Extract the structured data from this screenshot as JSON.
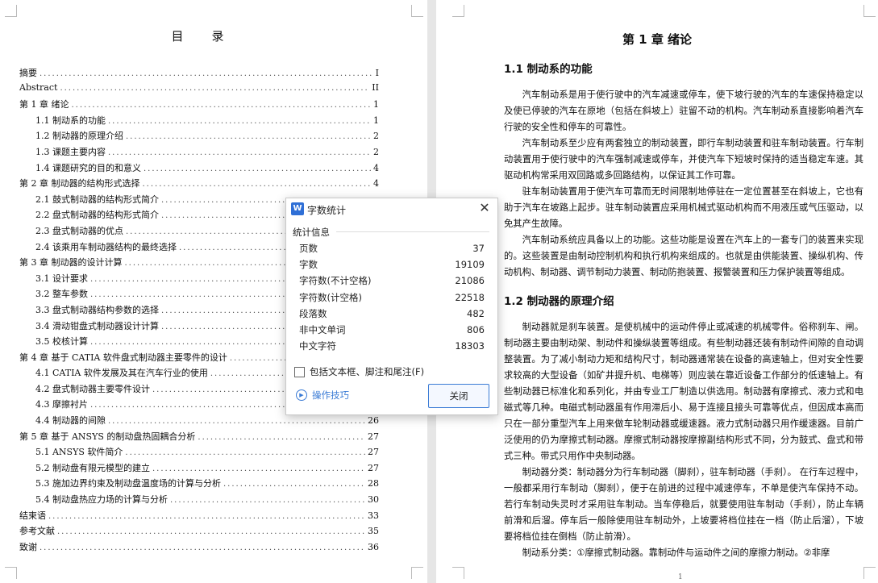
{
  "toc": {
    "title": "目　录",
    "entries": [
      {
        "label": "摘要",
        "page": "I",
        "level": 1
      },
      {
        "label": "Abstract",
        "page": "II",
        "level": 1
      },
      {
        "label": "第 1 章  绪论",
        "page": "1",
        "level": 1
      },
      {
        "label": "1.1 制动系的功能",
        "page": "1",
        "level": 2
      },
      {
        "label": "1.2 制动器的原理介绍",
        "page": "2",
        "level": 2
      },
      {
        "label": "1.3 课题主要内容",
        "page": "2",
        "level": 2
      },
      {
        "label": "1.4 课题研究的目的和意义",
        "page": "4",
        "level": 2
      },
      {
        "label": "第 2 章  制动器的结构形式选择",
        "page": "4",
        "level": 1
      },
      {
        "label": "2.1 鼓式制动器的结构形式简介",
        "page": "",
        "level": 2
      },
      {
        "label": "2.2 盘式制动器的结构形式简介",
        "page": "",
        "level": 2
      },
      {
        "label": "2.3 盘式制动器的优点",
        "page": "",
        "level": 2
      },
      {
        "label": "2.4 该乘用车制动器结构的最终选择",
        "page": "",
        "level": 2
      },
      {
        "label": "第 3 章    制动器的设计计算",
        "page": "",
        "level": 1
      },
      {
        "label": "3.1 设计要求",
        "page": "",
        "level": 2
      },
      {
        "label": "3.2 整车参数",
        "page": "",
        "level": 2
      },
      {
        "label": "3.3 盘式制动器结构参数的选择",
        "page": "",
        "level": 2
      },
      {
        "label": "3.4 滑动钳盘式制动器设计计算",
        "page": "",
        "level": 2
      },
      {
        "label": "3.5 校核计算",
        "page": "",
        "level": 2
      },
      {
        "label": "第 4 章  基于 CATIA 软件盘式制动器主要零件的设计",
        "page": "",
        "level": 1
      },
      {
        "label": "4.1 CATIA 软件发展及其在汽车行业的使用",
        "page": "",
        "level": 2
      },
      {
        "label": "4.2 盘式制动器主要零件设计",
        "page": "",
        "level": 2
      },
      {
        "label": "4.3 摩擦衬片",
        "page": "",
        "level": 2
      },
      {
        "label": "4.4 制动器的间隙",
        "page": "26",
        "level": 2
      },
      {
        "label": "第 5 章  基于 ANSYS 的制动盘热固耦合分析",
        "page": "27",
        "level": 1
      },
      {
        "label": "5.1 ANSYS 软件简介",
        "page": "27",
        "level": 2
      },
      {
        "label": "5.2 制动盘有限元模型的建立",
        "page": "27",
        "level": 2
      },
      {
        "label": "5.3 施加边界约束及制动盘温度场的计算与分析",
        "page": "28",
        "level": 2
      },
      {
        "label": "5.4 制动盘热应力场的计算与分析",
        "page": "30",
        "level": 2
      },
      {
        "label": "结束语",
        "page": "33",
        "level": 1
      },
      {
        "label": "参考文献",
        "page": "35",
        "level": 1
      },
      {
        "label": "致谢",
        "page": "36",
        "level": 1
      }
    ]
  },
  "right_page": {
    "chapter_title": "第 1 章  绪论",
    "sec1_title": "1.1 制动系的功能",
    "sec1_paragraphs": [
      "汽车制动系是用于使行驶中的汽车减速或停车，使下坡行驶的汽车的车速保持稳定以及使已停驶的汽车在原地（包括在斜坡上）驻留不动的机构。汽车制动系直接影响着汽车行驶的安全性和停车的可靠性。",
      "汽车制动系至少应有两套独立的制动装置，即行车制动装置和驻车制动装置。行车制动装置用于使行驶中的汽车强制减速或停车，并使汽车下短坡时保持的适当稳定车速。其驱动机构常采用双回路或多回路结构，以保证其工作可靠。",
      "驻车制动装置用于使汽车可靠而无时间限制地停驻在一定位置甚至在斜坡上，它也有助于汽车在坡路上起步。驻车制动装置应采用机械式驱动机构而不用液压或气压驱动，以免其产生故障。",
      "汽车制动系统应具备以上的功能。这些功能是设置在汽车上的一套专门的装置来实现的。这些装置是由制动控制机构和执行机构来组成的。也就是由供能装置、操纵机构、传动机构、制动器、调节制动力装置、制动防抱装置、报警装置和压力保护装置等组成。"
    ],
    "sec2_title": "1.2 制动器的原理介绍",
    "sec2_paragraphs": [
      "制动器就是刹车装置。是使机械中的运动件停止或减速的机械零件。俗称刹车、闸。制动器主要由制动架、制动件和操纵装置等组成。有些制动器还装有制动件间隙的自动调整装置。为了减小制动力矩和结构尺寸，制动器通常装在设备的高速轴上，但对安全性要求较高的大型设备（如矿井提升机、电梯等）则应装在靠近设备工作部分的低速轴上。有些制动器已标准化和系列化，并由专业工厂制造以供选用。制动器有摩擦式、液力式和电磁式等几种。电磁式制动器虽有作用滞后小、易于连接且接头可靠等优点，但因成本高而只在一部分重型汽车上用来做车轮制动器或缓速器。液力式制动器只用作缓速器。目前广泛使用的仍为摩擦式制动器。摩擦式制动器按摩擦副结构形式不同，分为鼓式、盘式和带式三种。带式只用作中央制动器。",
      "制动器分类：制动器分为行车制动器（脚刹），驻车制动器（手刹）。  在行车过程中，一般都采用行车制动（脚刹），便于在前进的过程中减速停车，不单是使汽车保持不动。若行车制动失灵时才采用驻车制动。当车停稳后，就要使用驻车制动（手刹），防止车辆前滑和后溜。停车后一般除使用驻车制动外，上坡要将档位挂在一档（防止后溜），下坡要将档位挂在倒档（防止前滑）。",
      "制动系分类：①摩擦式制动器。靠制动件与运动件之间的摩擦力制动。②非摩"
    ],
    "page_number": "1"
  },
  "dialog": {
    "logo": "W",
    "title": "字数统计",
    "section_label": "统计信息",
    "stats": [
      {
        "label": "页数",
        "value": "37"
      },
      {
        "label": "字数",
        "value": "19109"
      },
      {
        "label": "字符数(不计空格)",
        "value": "21086"
      },
      {
        "label": "字符数(计空格)",
        "value": "22518"
      },
      {
        "label": "段落数",
        "value": "482"
      },
      {
        "label": "非中文单词",
        "value": "806"
      },
      {
        "label": "中文字符",
        "value": "18303"
      }
    ],
    "checkbox_label": "包括文本框、脚注和尾注(F)",
    "tips_label": "操作技巧",
    "close_button": "关闭",
    "close_icon": "✕",
    "tips_icon": "▶"
  },
  "colors": {
    "accent": "#3a7bd5",
    "logo": "#2f6fd6"
  }
}
